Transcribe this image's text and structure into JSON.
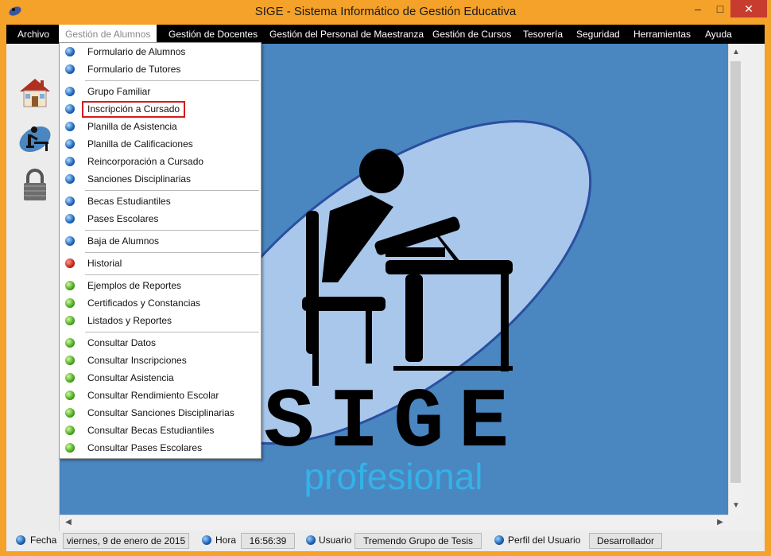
{
  "window": {
    "title": "SIGE - Sistema Informático de Gestión Educativa",
    "controls": {
      "minimize": "–",
      "maximize": "□",
      "close": "✕"
    }
  },
  "menubar": {
    "items": [
      {
        "label": "Archivo"
      },
      {
        "label": "Gestión de Alumnos"
      },
      {
        "label": "Gestión de Docentes"
      },
      {
        "label": "Gestión del Personal de Maestranza"
      },
      {
        "label": "Gestión de Cursos"
      },
      {
        "label": "Tesorería"
      },
      {
        "label": "Seguridad"
      },
      {
        "label": "Herramientas"
      },
      {
        "label": "Ayuda"
      }
    ],
    "active": "Gestión de Alumnos"
  },
  "sidebar": {
    "icons": [
      "home-icon",
      "student-desk-icon",
      "padlock-icon"
    ]
  },
  "dropdown": {
    "items": [
      {
        "label": "Formulario de Alumnos",
        "color": "blue"
      },
      {
        "label": "Formulario de Tutores",
        "color": "blue"
      },
      {
        "label": "Grupo Familiar",
        "color": "blue"
      },
      {
        "label": "Inscripción a Cursado",
        "color": "blue",
        "highlighted": true
      },
      {
        "label": "Planilla de Asistencia",
        "color": "blue"
      },
      {
        "label": "Planilla de Calificaciones",
        "color": "blue"
      },
      {
        "label": "Reincorporación a Cursado",
        "color": "blue"
      },
      {
        "label": "Sanciones Disciplinarias",
        "color": "blue"
      },
      {
        "label": "Becas Estudiantiles",
        "color": "blue"
      },
      {
        "label": "Pases Escolares",
        "color": "blue"
      },
      {
        "label": "Baja de Alumnos",
        "color": "blue"
      },
      {
        "label": "Historial",
        "color": "red"
      },
      {
        "label": "Ejemplos de Reportes",
        "color": "green"
      },
      {
        "label": "Certificados y Constancias",
        "color": "green"
      },
      {
        "label": "Listados y Reportes",
        "color": "green"
      },
      {
        "label": "Consultar Datos",
        "color": "green"
      },
      {
        "label": "Consultar Inscripciones",
        "color": "green"
      },
      {
        "label": "Consultar Asistencia",
        "color": "green"
      },
      {
        "label": "Consultar Rendimiento Escolar",
        "color": "green"
      },
      {
        "label": "Consultar Sanciones Disciplinarias",
        "color": "green"
      },
      {
        "label": "Consultar Becas Estudiantiles",
        "color": "green"
      },
      {
        "label": "Consultar Pases Escolares",
        "color": "green"
      }
    ]
  },
  "logo": {
    "word": "SIGE",
    "tagline": "profesional"
  },
  "statusbar": {
    "fecha_label": "Fecha",
    "fecha_value": "viernes, 9 de enero de 2015",
    "hora_label": "Hora",
    "hora_value": "16:56:39",
    "usuario_label": "Usuario",
    "usuario_value": "Tremendo Grupo de Tesis",
    "perfil_label": "Perfil del Usuario",
    "perfil_value": "Desarrollador"
  },
  "colors": {
    "frame": "#f4a22a",
    "menubar": "#000000",
    "canvas": "#4a86c0",
    "highlight_border": "#d41c1c"
  }
}
